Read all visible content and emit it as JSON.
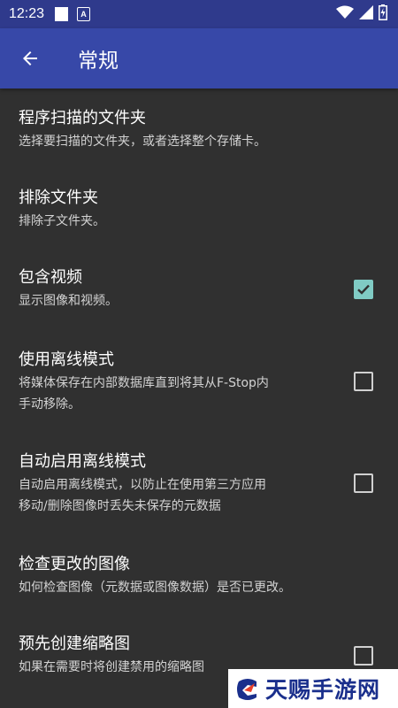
{
  "status_bar": {
    "time": "12:23",
    "notification_icons": [
      "square-notification-icon",
      "a-notification-icon"
    ],
    "system_icons": [
      "wifi-icon",
      "cellular-signal-icon",
      "battery-icon"
    ]
  },
  "app_bar": {
    "title": "常规",
    "background": "#3748a8"
  },
  "settings": [
    {
      "title": "程序扫描的文件夹",
      "summary": "选择要扫描的文件夹，或者选择整个存储卡。",
      "has_checkbox": false
    },
    {
      "title": "排除文件夹",
      "summary": "排除子文件夹。",
      "has_checkbox": false
    },
    {
      "title": "包含视频",
      "summary": "显示图像和视频。",
      "has_checkbox": true,
      "checked": true
    },
    {
      "title": "使用离线模式",
      "summary_line1": "将媒体保存在内部数据库直到将其从F-Stop内",
      "summary_line2": "手动移除。",
      "has_checkbox": true,
      "checked": false
    },
    {
      "title": "自动启用离线模式",
      "summary_line1": "自动启用离线模式，以防止在使用第三方应用",
      "summary_line2": "移动/删除图像时丢失未保存的元数据",
      "has_checkbox": true,
      "checked": false
    },
    {
      "title": "检查更改的图像",
      "summary": "如何检查图像（元数据或图像数据）是否已更改。",
      "has_checkbox": false
    },
    {
      "title": "预先创建缩略图",
      "summary": "如果在需要时将创建禁用的缩略图",
      "has_checkbox": true,
      "checked": false
    }
  ],
  "watermark": {
    "text": "天赐手游网"
  },
  "colors": {
    "accent_checkbox": "#80cbc4",
    "background": "#303030",
    "status_bar": "#2f3a8c"
  }
}
